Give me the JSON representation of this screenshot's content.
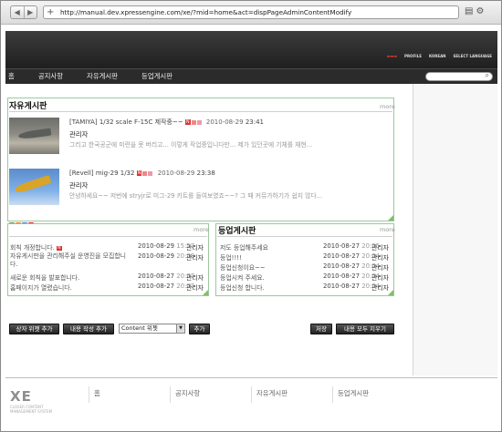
{
  "browser": {
    "url": "http://manual.dev.xpressengine.com/xe/?mid=home&act=dispPageAdminContentModify",
    "back_glyph": "◀",
    "forward_glyph": "▶",
    "new_tab_glyph": "+",
    "page_icon": "page-icon",
    "tools_icon": "gear-icon"
  },
  "header": {
    "top_menu": [
      "PROFILE",
      "KOREAN",
      "SELECT LANGUAGE"
    ]
  },
  "gnb": {
    "items": [
      "홈",
      "공지사항",
      "자유게시판",
      "등업게시판"
    ],
    "search_placeholder": ""
  },
  "free_board": {
    "title": "자유게시판",
    "more": "more",
    "posts": [
      {
        "title": "[TAMIYA] 1/32 scale F-15C 제작중~~",
        "date": "2010-08-29",
        "time": "23:41",
        "author": "관리자",
        "excerpt": "그리고 한국공군에 미련을 못 버리고... 이렇게 작업중입니다만... 제가 있던곳에 기체를 재현..."
      },
      {
        "title": "[Revell] mig-29 1/32",
        "date": "2010-08-29",
        "time": "23:38",
        "author": "관리자",
        "excerpt": "안녕하세요~~ 저번에 stryjr로 미그-29 키트를 들여보였죠~~? 그 때 커뮤가하기가 쉽지 않다..."
      }
    ]
  },
  "notice_list": {
    "more": "more",
    "rows": [
      {
        "title": "회칙 개정합니다.",
        "date": "2010-08-29",
        "time": "15:57",
        "author": "관리자",
        "is_new": true
      },
      {
        "title": "자유게시판을 관리해주실 운영진을 모집합니다.",
        "date": "2010-08-29",
        "time": "20:08",
        "author": "관리자",
        "is_new": false
      },
      {
        "title": "새로운 회칙을 발표합니다.",
        "date": "2010-08-27",
        "time": "20:07",
        "author": "관리자",
        "is_new": false
      },
      {
        "title": "홈페이지가 열렸습니다.",
        "date": "2010-08-27",
        "time": "20:07",
        "author": "관리자",
        "is_new": false
      }
    ]
  },
  "level_board": {
    "title": "등업게시판",
    "more": "more",
    "rows": [
      {
        "title": "저도 등업해주세요",
        "date": "2010-08-27",
        "time": "20:05",
        "author": "관리자"
      },
      {
        "title": "등업!!!!",
        "date": "2010-08-27",
        "time": "20:04",
        "author": "관리자"
      },
      {
        "title": "등업신청이요~~",
        "date": "2010-08-27",
        "time": "20:04",
        "author": "관리자"
      },
      {
        "title": "등업시켜 주세요.",
        "date": "2010-08-27",
        "time": "20:04",
        "author": "관리자"
      },
      {
        "title": "등업신청 합니다.",
        "date": "2010-08-27",
        "time": "20:04",
        "author": "관리자"
      }
    ]
  },
  "controls": {
    "add_box_widget": "상자 위젯 추가",
    "add_content": "내용 작성 추가",
    "select_value": "Content 위젯",
    "add": "추가",
    "save": "저장",
    "remove_all": "내용 모두 지우기"
  },
  "footer": {
    "logo": "XE",
    "tagline": "CLOSER CONTENT MANAGEMENT SYSTEM",
    "menu": [
      "홈",
      "공지사항",
      "자유게시판",
      "등업게시판"
    ]
  },
  "colors": {
    "header_dark": "#2b2b2b",
    "widget_border": "#9dc89d",
    "new_badge": "#dd3333"
  }
}
